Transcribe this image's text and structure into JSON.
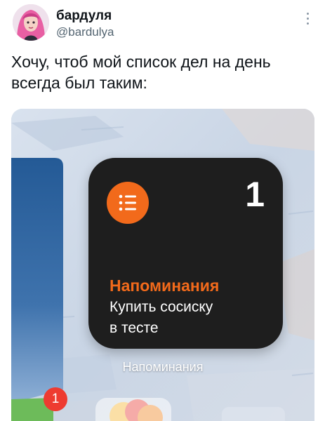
{
  "tweet": {
    "author_name": "бардуля",
    "author_handle": "@bardulya",
    "text_lines": [
      "Хочу, чтоб мой список дел на день",
      "всегда был таким:"
    ]
  },
  "widget": {
    "count": "1",
    "title": "Напоминания",
    "item_lines": [
      "Купить сосиску",
      "в тесте"
    ],
    "label": "Напоминания",
    "icon": "list-icon"
  },
  "home_screen": {
    "badge_count": "1"
  },
  "colors": {
    "accent_orange": "#f26a1b",
    "widget_bg": "#1e1e1e",
    "badge_red": "#ee3b30",
    "twitter_gray": "#536471"
  }
}
